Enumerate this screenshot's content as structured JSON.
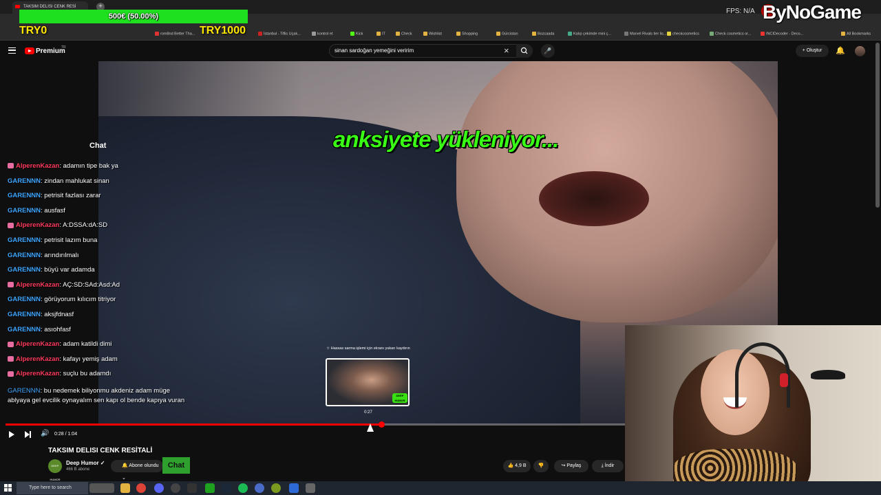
{
  "browser": {
    "tab_title": "TAKSIM DELISI CENK RESİ",
    "new_tab": "+",
    "bookmarks": [
      {
        "label": "rom8nd Better Tha...",
        "color": "#d33"
      },
      {
        "label": "İstanbul - Tiflis Uçak...",
        "color": "#c22"
      },
      {
        "label": "kontrol et",
        "color": "#999"
      },
      {
        "label": "Kick",
        "color": "#53fc18"
      },
      {
        "label": "IT",
        "color": "#e3b341"
      },
      {
        "label": "Check",
        "color": "#e3b341"
      },
      {
        "label": "Wishlist",
        "color": "#e3b341"
      },
      {
        "label": "Shopping",
        "color": "#e3b341"
      },
      {
        "label": "Gürcistan",
        "color": "#e3b341"
      },
      {
        "label": "Bozcaada",
        "color": "#e3b341"
      },
      {
        "label": "Kalıp çekimde mini ç...",
        "color": "#4a8"
      },
      {
        "label": "Marvel Rivals tier lis...",
        "color": "#777"
      },
      {
        "label": "checkcosmetics",
        "color": "#e3d341"
      },
      {
        "label": "Check cosmetics or...",
        "color": "#7a7"
      },
      {
        "label": "INCIDecoder - Deco...",
        "color": "#e33"
      },
      {
        "label": "All Bookmarks",
        "color": "#e3b341"
      }
    ]
  },
  "overlay": {
    "goal_text": "500€ (50.00%)",
    "goal_fraction": 1.0,
    "goal_left": "TRY0",
    "goal_right": "TRY1000",
    "fps": "FPS: N/A",
    "brand": "ByNoGame"
  },
  "youtube": {
    "brand": "Premium",
    "country": "TR",
    "search_query": "sinan sardoğan yemeğini veririm",
    "clear_icon": "×",
    "mic_icon": "🎤",
    "create_label": "+ Oluştur",
    "bell_icon": "🔔"
  },
  "video": {
    "caption": "anksiyete yükleniyor...",
    "preview_note": "☆ Hassas sarma işlemi için ekranı yukarı kaydırın",
    "preview_time": "0:27",
    "preview_logo": "DEEP HUMOR",
    "progress_fraction": 0.607,
    "time_display": "0:28 / 1:04",
    "volume_icon": "🔊"
  },
  "chat": {
    "title": "Chat",
    "messages": [
      {
        "user": "AlperenKazan",
        "text": ": adamın tipe bak ya",
        "color": "red",
        "badge": true
      },
      {
        "user": "GARENNN",
        "text": ": zindan mahlukat sinan",
        "color": "blue",
        "badge": false
      },
      {
        "user": "GARENNN",
        "text": ": petrisit fazlası zarar",
        "color": "blue",
        "badge": false
      },
      {
        "user": "GARENNN",
        "text": ": ausfasf",
        "color": "blue",
        "badge": false
      },
      {
        "user": "AlperenKazan",
        "text": ": A:DSSA:dA:SD",
        "color": "red",
        "badge": true
      },
      {
        "user": "GARENNN",
        "text": ": petrisit lazım buna",
        "color": "blue",
        "badge": false
      },
      {
        "user": "GARENNN",
        "text": ": arındırılmalı",
        "color": "blue",
        "badge": false
      },
      {
        "user": "GARENNN",
        "text": ": büyü var adamda",
        "color": "blue",
        "badge": false
      },
      {
        "user": "AlperenKazan",
        "text": ": AÇ:SD:SAd:Asd:Ad",
        "color": "red",
        "badge": true
      },
      {
        "user": "GARENNN",
        "text": ": görüyorum kılıcım titriyor",
        "color": "blue",
        "badge": false
      },
      {
        "user": "GARENNN",
        "text": ": aksjfdnasf",
        "color": "blue",
        "badge": false
      },
      {
        "user": "GARENNN",
        "text": ": asıohfasf",
        "color": "blue",
        "badge": false
      },
      {
        "user": "AlperenKazan",
        "text": ": adam katildi dimi",
        "color": "red",
        "badge": true
      },
      {
        "user": "AlperenKazan",
        "text": ": kafayı yemiş adam",
        "color": "red",
        "badge": true
      },
      {
        "user": "AlperenKazan",
        "text": ": suçlu bu adamdı",
        "color": "red",
        "badge": true
      }
    ],
    "last_user": "GARENNN",
    "last_text": ": bu nedemek biliyonmu akdeniz adam müge ablyaya gel evcilik oynayalım sen kapı ol bende kapıya vuran"
  },
  "below": {
    "title": "TAKSIM DELISI CENK RESİTALİ",
    "channel": "Deep Humor ✓",
    "channel_avatar": "DEEP HUMOR",
    "subscribers": "466 B abone",
    "subscribe_label": "🔔 Abone olundu ⌄",
    "chat_label": "Chat",
    "likes": "👍 4,9 B",
    "dislike": "👎",
    "share": "↪ Paylaş",
    "download": "⤓ İndir"
  },
  "taskbar": {
    "search_placeholder": "Type here to search"
  }
}
